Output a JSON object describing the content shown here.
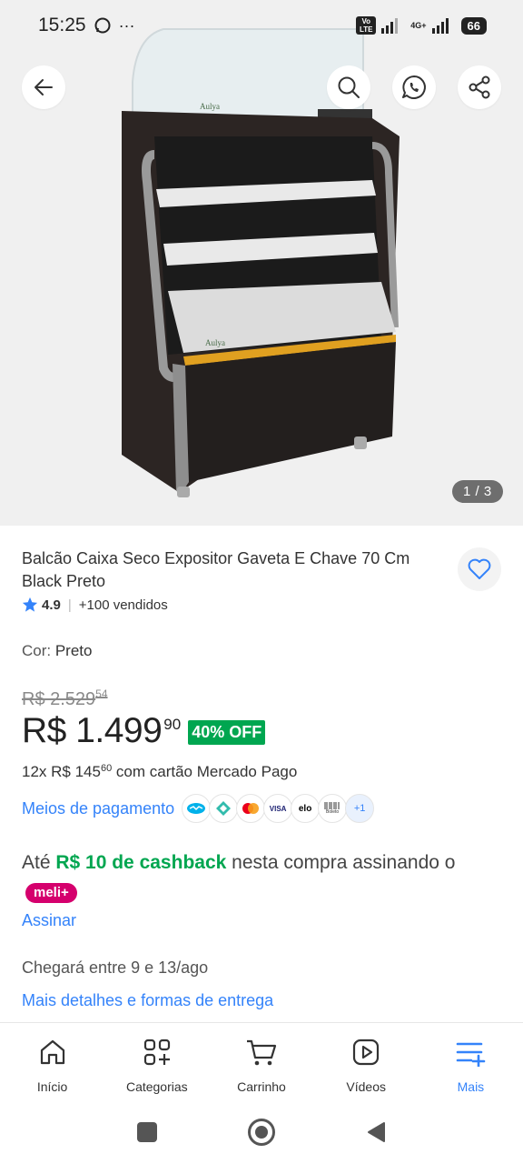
{
  "status_bar": {
    "time": "15:25",
    "more": "···",
    "network": "4G+",
    "volte": "Vo LTE",
    "battery": "66"
  },
  "gallery": {
    "counter": "1 / 3",
    "brand_marks": [
      "Aulya",
      "Aulya"
    ]
  },
  "product": {
    "title": "Balcão Caixa Seco Expositor Gaveta E Chave 70 Cm Black Preto",
    "rating": "4.9",
    "sold": "+100 vendidos",
    "color_label": "Cor: ",
    "color_value": "Preto",
    "old_price": "R$ 2.529",
    "old_price_cents": "54",
    "price": "R$ 1.499",
    "price_cents": "90",
    "discount": "40% OFF",
    "installments_prefix": "12x R$ 145",
    "installments_cents": "60",
    "installments_suffix": " com cartão Mercado Pago",
    "payment_link": "Meios de pagamento",
    "payment_icons": [
      "mercado-pago-icon",
      "pix-icon",
      "mastercard-icon",
      "visa-icon",
      "elo-icon",
      "boleto-icon"
    ],
    "payment_visa": "VISA",
    "payment_elo": "elo",
    "payment_boleto": "Boleto",
    "payment_more": "+1",
    "cashback_prefix": "Até ",
    "cashback_amount": "R$ 10 de cashback",
    "cashback_suffix": " nesta compra assinando o ",
    "meli_badge": "meli+",
    "subscribe_link": "Assinar",
    "delivery_text": "Chegará entre 9 e 13/ago",
    "delivery_link": "Mais detalhes e formas de entrega"
  },
  "bottom_nav": [
    {
      "label": "Início",
      "icon": "home-icon"
    },
    {
      "label": "Categorias",
      "icon": "categories-icon"
    },
    {
      "label": "Carrinho",
      "icon": "cart-icon"
    },
    {
      "label": "Vídeos",
      "icon": "video-icon"
    },
    {
      "label": "Mais",
      "icon": "menu-plus-icon"
    }
  ],
  "colors": {
    "accent": "#3483fa",
    "green": "#00a650",
    "meli": "#d5006d",
    "hero_bg": "#f0f0f0"
  }
}
